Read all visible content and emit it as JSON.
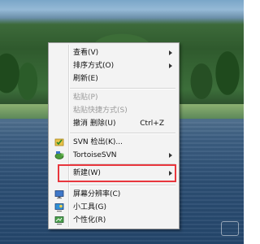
{
  "context_menu": {
    "items": [
      {
        "label": "查看(V)"
      },
      {
        "label": "排序方式(O)"
      },
      {
        "label": "刷新(E)"
      },
      {
        "label": "粘贴(P)"
      },
      {
        "label": "粘贴快捷方式(S)"
      },
      {
        "label": "撤消 删除(U)",
        "shortcut": "Ctrl+Z"
      },
      {
        "label": "SVN 检出(K)..."
      },
      {
        "label": "TortoiseSVN"
      },
      {
        "label": "新建(W)"
      },
      {
        "label": "屏幕分辨率(C)"
      },
      {
        "label": "小工具(G)"
      },
      {
        "label": "个性化(R)"
      }
    ],
    "highlight_color": "#e8363d"
  }
}
